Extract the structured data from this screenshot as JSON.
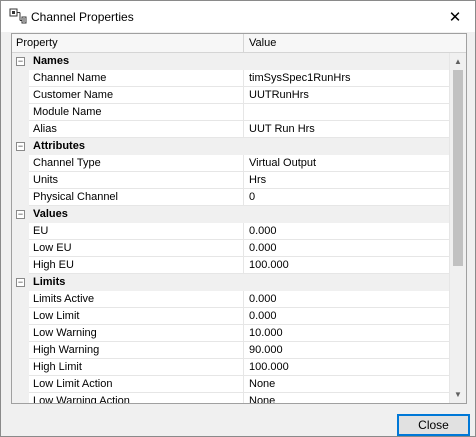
{
  "window": {
    "title": "Channel Properties",
    "title_icon": "channel-properties-icon",
    "close_glyph": "✕"
  },
  "grid": {
    "columns": {
      "property": "Property",
      "value": "Value"
    },
    "categories": [
      {
        "label": "Names",
        "toggle": "−",
        "rows": [
          {
            "property": "Channel Name",
            "value": "timSysSpec1RunHrs"
          },
          {
            "property": "Customer Name",
            "value": "UUTRunHrs"
          },
          {
            "property": "Module Name",
            "value": ""
          },
          {
            "property": "Alias",
            "value": "UUT Run Hrs"
          }
        ]
      },
      {
        "label": "Attributes",
        "toggle": "−",
        "rows": [
          {
            "property": "Channel Type",
            "value": "Virtual Output"
          },
          {
            "property": "Units",
            "value": "Hrs"
          },
          {
            "property": "Physical Channel",
            "value": "0"
          }
        ]
      },
      {
        "label": "Values",
        "toggle": "−",
        "rows": [
          {
            "property": "EU",
            "value": "0.000"
          },
          {
            "property": "Low EU",
            "value": "0.000"
          },
          {
            "property": "High EU",
            "value": "100.000"
          }
        ]
      },
      {
        "label": "Limits",
        "toggle": "−",
        "rows": [
          {
            "property": "Limits Active",
            "value": "0.000"
          },
          {
            "property": "Low Limit",
            "value": "0.000"
          },
          {
            "property": "Low Warning",
            "value": "10.000"
          },
          {
            "property": "High Warning",
            "value": "90.000"
          },
          {
            "property": "High Limit",
            "value": "100.000"
          },
          {
            "property": "Low Limit Action",
            "value": "None"
          },
          {
            "property": "Low Warning Action",
            "value": "None"
          }
        ]
      }
    ],
    "scrollbar": {
      "up_glyph": "▲",
      "down_glyph": "▼"
    }
  },
  "footer": {
    "close_label": "Close"
  }
}
